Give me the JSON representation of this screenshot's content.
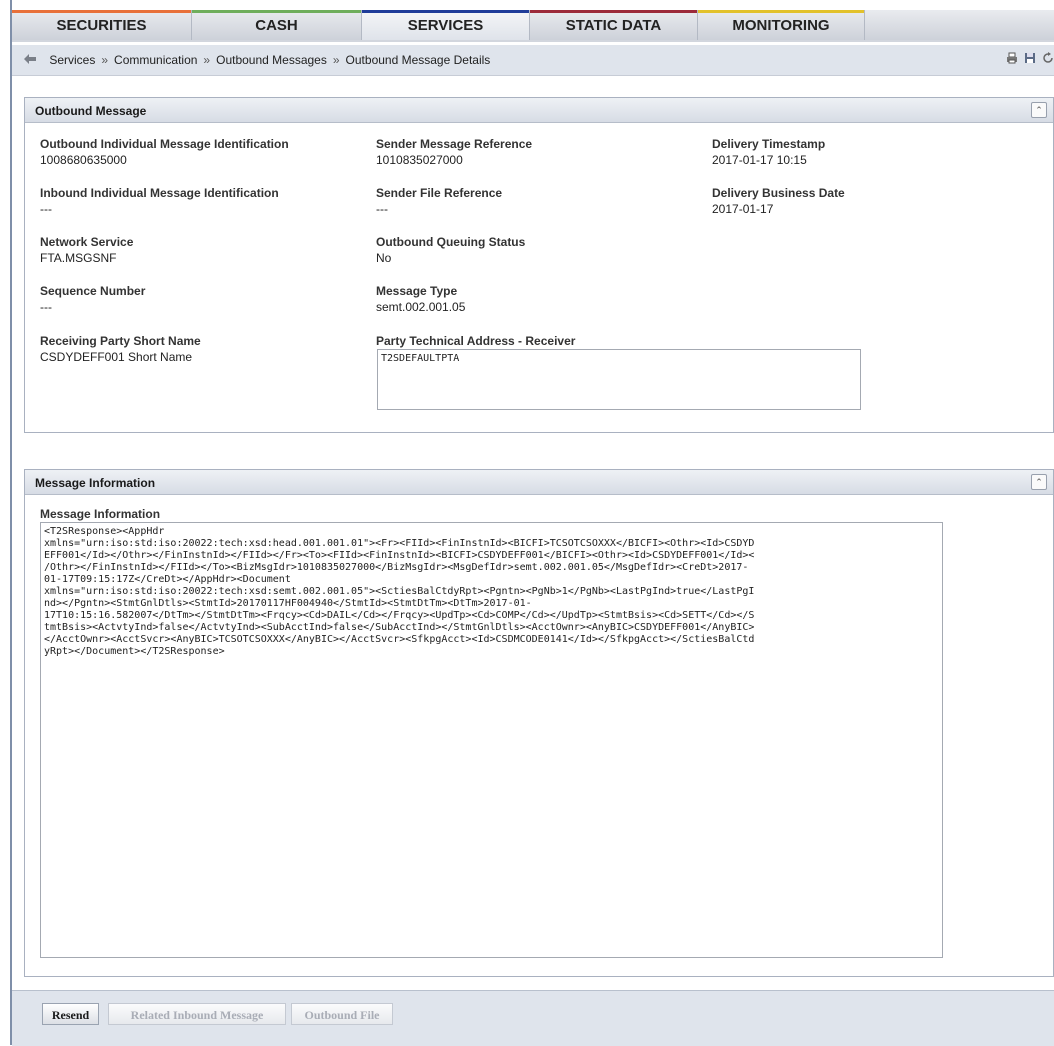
{
  "nav": {
    "tabs": [
      {
        "label": "SECURITIES",
        "color": "#e8703a"
      },
      {
        "label": "CASH",
        "color": "#6fae5c"
      },
      {
        "label": "SERVICES",
        "color": "#1f3c99"
      },
      {
        "label": "STATIC DATA",
        "color": "#9c2a3a"
      },
      {
        "label": "MONITORING",
        "color": "#e2c12b"
      }
    ],
    "active": "SERVICES"
  },
  "breadcrumb": {
    "items": [
      "Services",
      "Communication",
      "Outbound Messages",
      "Outbound Message Details"
    ],
    "separator": "»"
  },
  "outbound": {
    "title": "Outbound Message",
    "fields": {
      "out_id": {
        "label": "Outbound Individual Message Identification",
        "value": "1008680635000"
      },
      "sender_ref": {
        "label": "Sender Message Reference",
        "value": "1010835027000"
      },
      "delivery_ts": {
        "label": "Delivery Timestamp",
        "value": "2017-01-17 10:15"
      },
      "in_id": {
        "label": "Inbound Individual Message Identification",
        "value": "---"
      },
      "sender_file": {
        "label": "Sender File Reference",
        "value": "---"
      },
      "delivery_bd": {
        "label": "Delivery Business Date",
        "value": "2017-01-17"
      },
      "network": {
        "label": "Network Service",
        "value": "FTA.MSGSNF"
      },
      "queuing": {
        "label": "Outbound Queuing Status",
        "value": "No"
      },
      "sequence": {
        "label": "Sequence Number",
        "value": "---"
      },
      "msg_type": {
        "label": "Message Type",
        "value": "semt.002.001.05"
      },
      "receiving": {
        "label": "Receiving Party Short Name",
        "value": "CSDYDEFF001 Short Name"
      },
      "pta": {
        "label": "Party Technical Address - Receiver",
        "value": "T2SDEFAULTPTA"
      }
    }
  },
  "message_info": {
    "title": "Message Information",
    "label": "Message Information",
    "lines": [
      "<T2SResponse><AppHdr",
      "xmlns=\"urn:iso:std:iso:20022:tech:xsd:head.001.001.01\"><Fr><FIId><FinInstnId><BICFI>TCSOTCSOXXX</BICFI><Othr><Id>CSDYD",
      "EFF001</Id></Othr></FinInstnId></FIId></Fr><To><FIId><FinInstnId><BICFI>CSDYDEFF001</BICFI><Othr><Id>CSDYDEFF001</Id><",
      "/Othr></FinInstnId></FIId></To><BizMsgIdr>1010835027000</BizMsgIdr><MsgDefIdr>semt.002.001.05</MsgDefIdr><CreDt>2017-",
      "01-17T09:15:17Z</CreDt></AppHdr><Document",
      "xmlns=\"urn:iso:std:iso:20022:tech:xsd:semt.002.001.05\"><SctiesBalCtdyRpt><Pgntn><PgNb>1</PgNb><LastPgInd>true</LastPgI",
      "nd></Pgntn><StmtGnlDtls><StmtId>20170117HF004940</StmtId><StmtDtTm><DtTm>2017-01-",
      "17T10:15:16.582007</DtTm></StmtDtTm><Frqcy><Cd>DAIL</Cd></Frqcy><UpdTp><Cd>COMP</Cd></UpdTp><StmtBsis><Cd>SETT</Cd></S",
      "tmtBsis><ActvtyInd>false</ActvtyInd><SubAcctInd>false</SubAcctInd></StmtGnlDtls><AcctOwnr><AnyBIC>CSDYDEFF001</AnyBIC>",
      "</AcctOwnr><AcctSvcr><AnyBIC>TCSOTCSOXXX</AnyBIC></AcctSvcr><SfkpgAcct><Id>CSDMCODE0141</Id></SfkpgAcct></SctiesBalCtd",
      "yRpt></Document></T2SResponse>"
    ]
  },
  "buttons": {
    "resend": "Resend",
    "related": "Related Inbound Message",
    "outbound_file": "Outbound File"
  }
}
